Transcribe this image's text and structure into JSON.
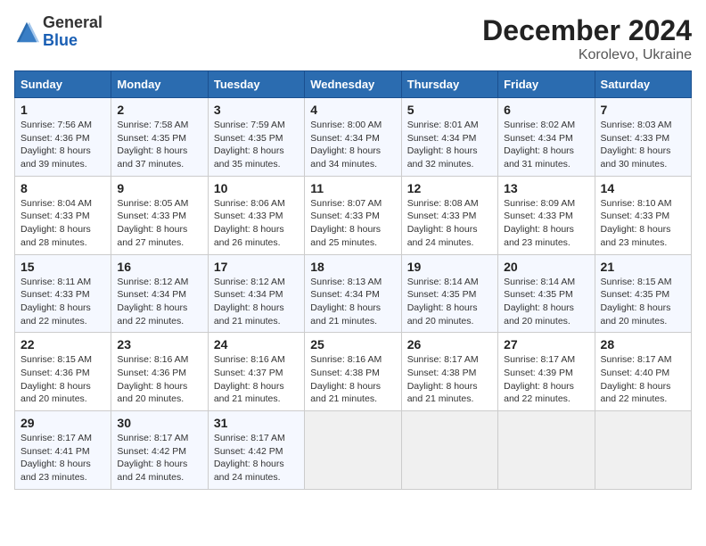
{
  "header": {
    "logo_text_general": "General",
    "logo_text_blue": "Blue",
    "title": "December 2024",
    "subtitle": "Korolevo, Ukraine"
  },
  "calendar": {
    "columns": [
      "Sunday",
      "Monday",
      "Tuesday",
      "Wednesday",
      "Thursday",
      "Friday",
      "Saturday"
    ],
    "weeks": [
      [
        {
          "day": "1",
          "sunrise": "7:56 AM",
          "sunset": "4:36 PM",
          "daylight": "8 hours and 39 minutes."
        },
        {
          "day": "2",
          "sunrise": "7:58 AM",
          "sunset": "4:35 PM",
          "daylight": "8 hours and 37 minutes."
        },
        {
          "day": "3",
          "sunrise": "7:59 AM",
          "sunset": "4:35 PM",
          "daylight": "8 hours and 35 minutes."
        },
        {
          "day": "4",
          "sunrise": "8:00 AM",
          "sunset": "4:34 PM",
          "daylight": "8 hours and 34 minutes."
        },
        {
          "day": "5",
          "sunrise": "8:01 AM",
          "sunset": "4:34 PM",
          "daylight": "8 hours and 32 minutes."
        },
        {
          "day": "6",
          "sunrise": "8:02 AM",
          "sunset": "4:34 PM",
          "daylight": "8 hours and 31 minutes."
        },
        {
          "day": "7",
          "sunrise": "8:03 AM",
          "sunset": "4:33 PM",
          "daylight": "8 hours and 30 minutes."
        }
      ],
      [
        {
          "day": "8",
          "sunrise": "8:04 AM",
          "sunset": "4:33 PM",
          "daylight": "8 hours and 28 minutes."
        },
        {
          "day": "9",
          "sunrise": "8:05 AM",
          "sunset": "4:33 PM",
          "daylight": "8 hours and 27 minutes."
        },
        {
          "day": "10",
          "sunrise": "8:06 AM",
          "sunset": "4:33 PM",
          "daylight": "8 hours and 26 minutes."
        },
        {
          "day": "11",
          "sunrise": "8:07 AM",
          "sunset": "4:33 PM",
          "daylight": "8 hours and 25 minutes."
        },
        {
          "day": "12",
          "sunrise": "8:08 AM",
          "sunset": "4:33 PM",
          "daylight": "8 hours and 24 minutes."
        },
        {
          "day": "13",
          "sunrise": "8:09 AM",
          "sunset": "4:33 PM",
          "daylight": "8 hours and 23 minutes."
        },
        {
          "day": "14",
          "sunrise": "8:10 AM",
          "sunset": "4:33 PM",
          "daylight": "8 hours and 23 minutes."
        }
      ],
      [
        {
          "day": "15",
          "sunrise": "8:11 AM",
          "sunset": "4:33 PM",
          "daylight": "8 hours and 22 minutes."
        },
        {
          "day": "16",
          "sunrise": "8:12 AM",
          "sunset": "4:34 PM",
          "daylight": "8 hours and 22 minutes."
        },
        {
          "day": "17",
          "sunrise": "8:12 AM",
          "sunset": "4:34 PM",
          "daylight": "8 hours and 21 minutes."
        },
        {
          "day": "18",
          "sunrise": "8:13 AM",
          "sunset": "4:34 PM",
          "daylight": "8 hours and 21 minutes."
        },
        {
          "day": "19",
          "sunrise": "8:14 AM",
          "sunset": "4:35 PM",
          "daylight": "8 hours and 20 minutes."
        },
        {
          "day": "20",
          "sunrise": "8:14 AM",
          "sunset": "4:35 PM",
          "daylight": "8 hours and 20 minutes."
        },
        {
          "day": "21",
          "sunrise": "8:15 AM",
          "sunset": "4:35 PM",
          "daylight": "8 hours and 20 minutes."
        }
      ],
      [
        {
          "day": "22",
          "sunrise": "8:15 AM",
          "sunset": "4:36 PM",
          "daylight": "8 hours and 20 minutes."
        },
        {
          "day": "23",
          "sunrise": "8:16 AM",
          "sunset": "4:36 PM",
          "daylight": "8 hours and 20 minutes."
        },
        {
          "day": "24",
          "sunrise": "8:16 AM",
          "sunset": "4:37 PM",
          "daylight": "8 hours and 21 minutes."
        },
        {
          "day": "25",
          "sunrise": "8:16 AM",
          "sunset": "4:38 PM",
          "daylight": "8 hours and 21 minutes."
        },
        {
          "day": "26",
          "sunrise": "8:17 AM",
          "sunset": "4:38 PM",
          "daylight": "8 hours and 21 minutes."
        },
        {
          "day": "27",
          "sunrise": "8:17 AM",
          "sunset": "4:39 PM",
          "daylight": "8 hours and 22 minutes."
        },
        {
          "day": "28",
          "sunrise": "8:17 AM",
          "sunset": "4:40 PM",
          "daylight": "8 hours and 22 minutes."
        }
      ],
      [
        {
          "day": "29",
          "sunrise": "8:17 AM",
          "sunset": "4:41 PM",
          "daylight": "8 hours and 23 minutes."
        },
        {
          "day": "30",
          "sunrise": "8:17 AM",
          "sunset": "4:42 PM",
          "daylight": "8 hours and 24 minutes."
        },
        {
          "day": "31",
          "sunrise": "8:17 AM",
          "sunset": "4:42 PM",
          "daylight": "8 hours and 24 minutes."
        },
        null,
        null,
        null,
        null
      ]
    ]
  }
}
